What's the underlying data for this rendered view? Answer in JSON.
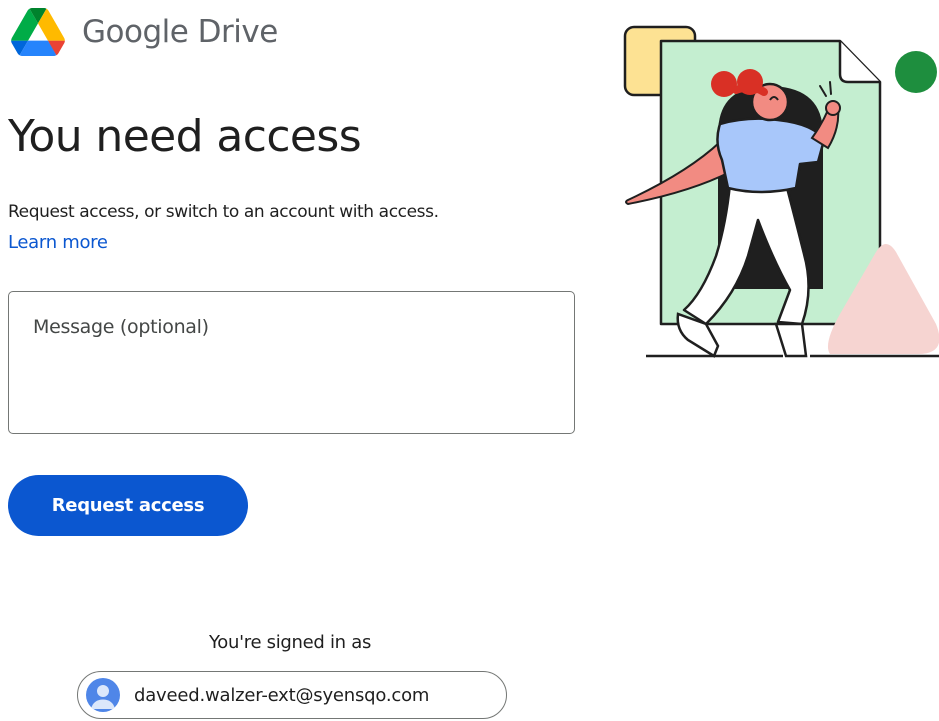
{
  "header": {
    "product_name": "Google Drive",
    "logo_icon": "google-drive-logo"
  },
  "main": {
    "title": "You need access",
    "subtitle": "Request access, or switch to an account with access.",
    "learn_more_label": "Learn more",
    "message_placeholder": "Message (optional)",
    "message_value": "",
    "request_button_label": "Request access"
  },
  "account": {
    "signed_in_label": "You're signed in as",
    "email": "daveed.walzer-ext@syensqo.com",
    "avatar_icon": "person-icon"
  },
  "illustration": {
    "description_icon": "person-entering-document-illustration"
  },
  "colors": {
    "primary": "#0b57d0",
    "link": "#0b57d0",
    "text": "#1f1f1f",
    "muted": "#5f6368",
    "border": "#747775",
    "drive_green": "#0f9d58",
    "drive_yellow": "#fbbc04",
    "drive_blue": "#4285f4",
    "drive_red": "#ea4335"
  }
}
